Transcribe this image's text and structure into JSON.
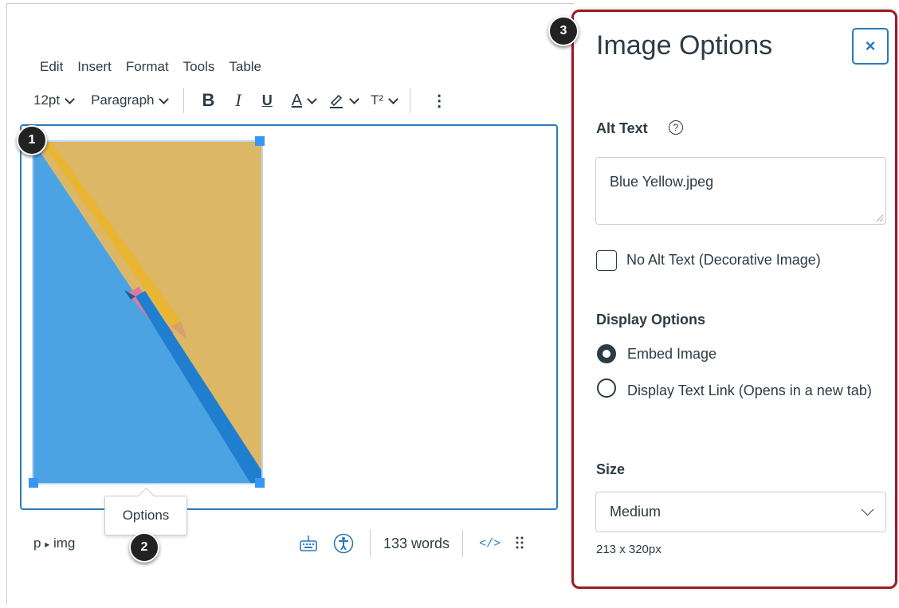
{
  "menu": [
    "Edit",
    "Insert",
    "Format",
    "Tools",
    "Table"
  ],
  "toolbar": {
    "font_size": "12pt",
    "block_format": "Paragraph",
    "bold": "B",
    "italic": "I",
    "underline": "U",
    "text_color": "A",
    "superscript": "T²",
    "more": "⋮"
  },
  "image": {
    "alt": "Blue Yellow.jpeg"
  },
  "options_tooltip": "Options",
  "status": {
    "path_p": "p",
    "path_sep": "▸",
    "path_img": "img",
    "word_count": "133 words",
    "html_toggle": "</>"
  },
  "callouts": [
    "1",
    "2",
    "3"
  ],
  "panel": {
    "title": "Image Options",
    "close": "×",
    "alt_text_label": "Alt Text",
    "help": "?",
    "alt_text_value": "Blue Yellow.jpeg",
    "no_alt_label": "No Alt Text (Decorative Image)",
    "display_options_label": "Display Options",
    "embed_label": "Embed Image",
    "link_label": "Display Text Link (Opens in a new tab)",
    "size_label": "Size",
    "size_value": "Medium",
    "dimensions": "213 x 320px"
  },
  "colors": {
    "panel_border": "#9b1c25",
    "accent": "#2b7abc",
    "handle": "#3596f5",
    "image_blue": "#4ba3e3",
    "image_yellow": "#dcb765"
  }
}
